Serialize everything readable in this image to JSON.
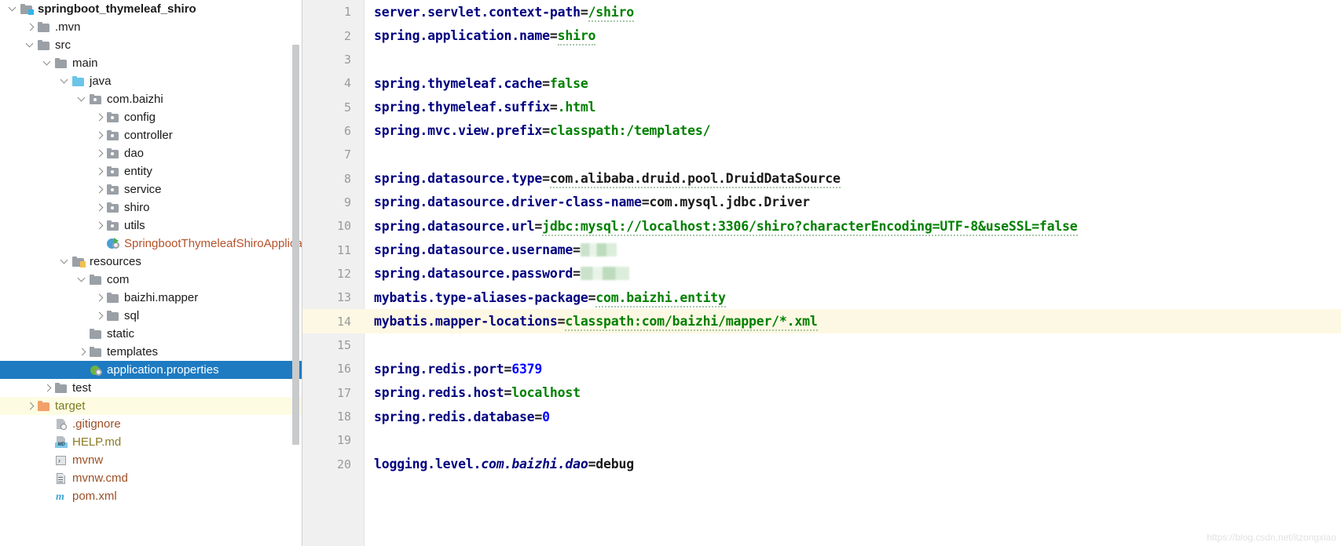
{
  "project_tree": {
    "scrollbar_present": true,
    "items": [
      {
        "label": "springboot_thymeleaf_shiro",
        "depth": 0,
        "arrow": "expanded",
        "icon": "folder-module-icon",
        "style": "bold",
        "state": "normal"
      },
      {
        "label": ".mvn",
        "depth": 1,
        "arrow": "collapsed",
        "icon": "folder-icon",
        "style": "normal",
        "state": "normal"
      },
      {
        "label": "src",
        "depth": 1,
        "arrow": "expanded",
        "icon": "folder-icon",
        "style": "normal",
        "state": "normal"
      },
      {
        "label": "main",
        "depth": 2,
        "arrow": "expanded",
        "icon": "folder-icon",
        "style": "normal",
        "state": "normal"
      },
      {
        "label": "java",
        "depth": 3,
        "arrow": "expanded",
        "icon": "folder-source-icon",
        "style": "normal",
        "state": "normal"
      },
      {
        "label": "com.baizhi",
        "depth": 4,
        "arrow": "expanded",
        "icon": "folder-package-icon",
        "style": "normal",
        "state": "normal"
      },
      {
        "label": "config",
        "depth": 5,
        "arrow": "collapsed",
        "icon": "folder-package-icon",
        "style": "normal",
        "state": "normal"
      },
      {
        "label": "controller",
        "depth": 5,
        "arrow": "collapsed",
        "icon": "folder-package-icon",
        "style": "normal",
        "state": "normal"
      },
      {
        "label": "dao",
        "depth": 5,
        "arrow": "collapsed",
        "icon": "folder-package-icon",
        "style": "normal",
        "state": "normal"
      },
      {
        "label": "entity",
        "depth": 5,
        "arrow": "collapsed",
        "icon": "folder-package-icon",
        "style": "normal",
        "state": "normal"
      },
      {
        "label": "service",
        "depth": 5,
        "arrow": "collapsed",
        "icon": "folder-package-icon",
        "style": "normal",
        "state": "normal"
      },
      {
        "label": "shiro",
        "depth": 5,
        "arrow": "collapsed",
        "icon": "folder-package-icon",
        "style": "normal",
        "state": "normal"
      },
      {
        "label": "utils",
        "depth": 5,
        "arrow": "collapsed",
        "icon": "folder-package-icon",
        "style": "normal",
        "state": "normal"
      },
      {
        "label": "SpringbootThymeleafShiroApplication",
        "depth": 5,
        "arrow": "none",
        "icon": "java-class-runnable-icon",
        "style": "orange-file",
        "state": "normal"
      },
      {
        "label": "resources",
        "depth": 3,
        "arrow": "expanded",
        "icon": "folder-resources-icon",
        "style": "normal",
        "state": "normal"
      },
      {
        "label": "com",
        "depth": 4,
        "arrow": "expanded",
        "icon": "folder-icon",
        "style": "normal",
        "state": "normal"
      },
      {
        "label": "baizhi.mapper",
        "depth": 5,
        "arrow": "collapsed",
        "icon": "folder-icon",
        "style": "normal",
        "state": "normal"
      },
      {
        "label": "sql",
        "depth": 5,
        "arrow": "collapsed",
        "icon": "folder-icon",
        "style": "normal",
        "state": "normal"
      },
      {
        "label": "static",
        "depth": 4,
        "arrow": "none",
        "icon": "folder-icon",
        "style": "normal",
        "state": "normal"
      },
      {
        "label": "templates",
        "depth": 4,
        "arrow": "collapsed",
        "icon": "folder-icon",
        "style": "normal",
        "state": "normal"
      },
      {
        "label": "application.properties",
        "depth": 4,
        "arrow": "none",
        "icon": "spring-properties-icon",
        "style": "normal",
        "state": "selected"
      },
      {
        "label": "test",
        "depth": 2,
        "arrow": "collapsed",
        "icon": "folder-icon",
        "style": "normal",
        "state": "normal"
      },
      {
        "label": "target",
        "depth": 1,
        "arrow": "collapsed",
        "icon": "folder-excluded-icon",
        "style": "olive",
        "state": "highlighted"
      },
      {
        "label": ".gitignore",
        "depth": 2,
        "arrow": "none",
        "icon": "gitignore-file-icon",
        "style": "brown",
        "state": "normal"
      },
      {
        "label": "HELP.md",
        "depth": 2,
        "arrow": "none",
        "icon": "markdown-file-icon",
        "style": "mustard",
        "state": "normal"
      },
      {
        "label": "mvnw",
        "depth": 2,
        "arrow": "none",
        "icon": "shell-script-icon",
        "style": "brown",
        "state": "normal"
      },
      {
        "label": "mvnw.cmd",
        "depth": 2,
        "arrow": "none",
        "icon": "cmd-script-icon",
        "style": "brown",
        "state": "normal"
      },
      {
        "label": "pom.xml",
        "depth": 2,
        "arrow": "none",
        "icon": "maven-pom-icon",
        "style": "brown",
        "state": "normal"
      }
    ]
  },
  "editor": {
    "caret_line": 14,
    "colors": {
      "key": "#000080",
      "value_string": "#008000",
      "value_number": "#0000ff",
      "caret_line_bg": "#fdf8e3",
      "gutter_bg": "#f0f0f0",
      "selection_bg": "#1e7bc2"
    },
    "lines": [
      {
        "n": "1",
        "tokens": [
          {
            "t": "server.servlet.context-path",
            "c": "k"
          },
          {
            "t": "=",
            "c": "eq"
          },
          {
            "t": "/shiro",
            "c": "v",
            "squiggly": true
          }
        ]
      },
      {
        "n": "2",
        "tokens": [
          {
            "t": "spring.application.name",
            "c": "k"
          },
          {
            "t": "=",
            "c": "eq"
          },
          {
            "t": "shiro",
            "c": "v",
            "squiggly": true
          }
        ]
      },
      {
        "n": "3",
        "tokens": []
      },
      {
        "n": "4",
        "tokens": [
          {
            "t": "spring.thymeleaf.cache",
            "c": "k"
          },
          {
            "t": "=",
            "c": "eq"
          },
          {
            "t": "false",
            "c": "v"
          }
        ]
      },
      {
        "n": "5",
        "tokens": [
          {
            "t": "spring.thymeleaf.suffix",
            "c": "k"
          },
          {
            "t": "=",
            "c": "eq"
          },
          {
            "t": ".html",
            "c": "v"
          }
        ]
      },
      {
        "n": "6",
        "tokens": [
          {
            "t": "spring.mvc.view.prefix",
            "c": "k"
          },
          {
            "t": "=",
            "c": "eq"
          },
          {
            "t": "classpath:/templates/",
            "c": "v"
          }
        ]
      },
      {
        "n": "7",
        "tokens": []
      },
      {
        "n": "8",
        "tokens": [
          {
            "t": "spring.datasource.type",
            "c": "k"
          },
          {
            "t": "=",
            "c": "eq"
          },
          {
            "t": "com.alibaba.druid.pool.DruidDataSource",
            "c": "plain",
            "squiggly": true
          }
        ]
      },
      {
        "n": "9",
        "tokens": [
          {
            "t": "spring.datasource.driver-class-name",
            "c": "k"
          },
          {
            "t": "=",
            "c": "eq"
          },
          {
            "t": "com.mysql.jdbc.Driver",
            "c": "plain"
          }
        ]
      },
      {
        "n": "10",
        "tokens": [
          {
            "t": "spring.datasource.url",
            "c": "k"
          },
          {
            "t": "=",
            "c": "eq"
          },
          {
            "t": "jdbc:mysql://localhost:3306/shiro?characterEncoding=UTF-8&useSSL=false",
            "c": "v",
            "squiggly": true
          }
        ]
      },
      {
        "n": "11",
        "tokens": [
          {
            "t": "spring.datasource.username",
            "c": "k"
          },
          {
            "t": "=",
            "c": "eq"
          }
        ],
        "redacted": "small"
      },
      {
        "n": "12",
        "tokens": [
          {
            "t": "spring.datasource.password",
            "c": "k"
          },
          {
            "t": "=",
            "c": "eq"
          }
        ],
        "redacted": "wide"
      },
      {
        "n": "13",
        "tokens": [
          {
            "t": "mybatis.type-aliases-package",
            "c": "k"
          },
          {
            "t": "=",
            "c": "eq"
          },
          {
            "t": "com.baizhi.entity",
            "c": "v",
            "squiggly": true
          }
        ]
      },
      {
        "n": "14",
        "tokens": [
          {
            "t": "mybatis.mapper-locations",
            "c": "k"
          },
          {
            "t": "=",
            "c": "eq"
          },
          {
            "t": "classpath:com/baizhi/mapper/*.xml",
            "c": "v",
            "squiggly": true
          }
        ]
      },
      {
        "n": "15",
        "tokens": []
      },
      {
        "n": "16",
        "tokens": [
          {
            "t": "spring.redis.port",
            "c": "k"
          },
          {
            "t": "=",
            "c": "eq"
          },
          {
            "t": "6379",
            "c": "n"
          }
        ]
      },
      {
        "n": "17",
        "tokens": [
          {
            "t": "spring.redis.host",
            "c": "k"
          },
          {
            "t": "=",
            "c": "eq"
          },
          {
            "t": "localhost",
            "c": "v"
          }
        ]
      },
      {
        "n": "18",
        "tokens": [
          {
            "t": "spring.redis.database",
            "c": "k"
          },
          {
            "t": "=",
            "c": "eq"
          },
          {
            "t": "0",
            "c": "n"
          }
        ]
      },
      {
        "n": "19",
        "tokens": []
      },
      {
        "n": "20",
        "tokens": [
          {
            "t": "logging.level.",
            "c": "k"
          },
          {
            "t": "com.baizhi.dao",
            "c": "ki"
          },
          {
            "t": "=",
            "c": "eq"
          },
          {
            "t": "debug",
            "c": "plain"
          }
        ]
      }
    ]
  },
  "watermark": {
    "text": "https://blog.csdn.net/itzongxiao"
  }
}
